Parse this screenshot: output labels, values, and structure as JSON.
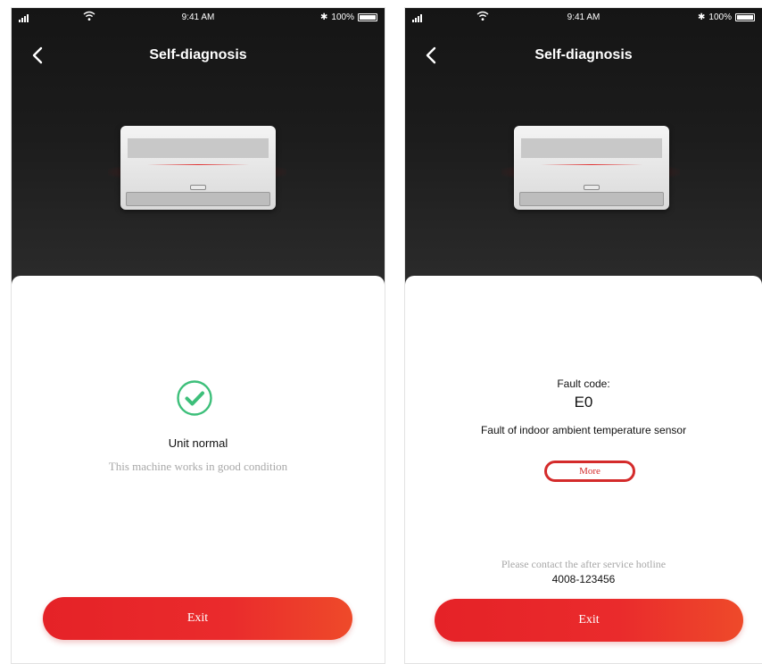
{
  "status_bar": {
    "time": "9:41 AM",
    "battery": "100%",
    "bluetooth": "✱"
  },
  "screens": [
    {
      "title": "Self-diagnosis",
      "status_title": "Unit normal",
      "status_subtitle": "This machine works in good condition",
      "exit_label": "Exit"
    },
    {
      "title": "Self-diagnosis",
      "fault_label": "Fault code:",
      "fault_code": "E0",
      "fault_description": "Fault of indoor ambient temperature sensor",
      "more_label": "More",
      "contact_text": "Please contact the after service hotline",
      "hotline": "4008-123456",
      "exit_label": "Exit"
    }
  ],
  "colors": {
    "accent_red": "#e52227",
    "success_green": "#3dbf7a",
    "header_dark": "#1c1c1c"
  },
  "icons": [
    "signal-icon",
    "wifi-icon",
    "bluetooth-icon",
    "battery-icon",
    "back-arrow-icon",
    "air-conditioner-icon",
    "check-circle-icon"
  ]
}
